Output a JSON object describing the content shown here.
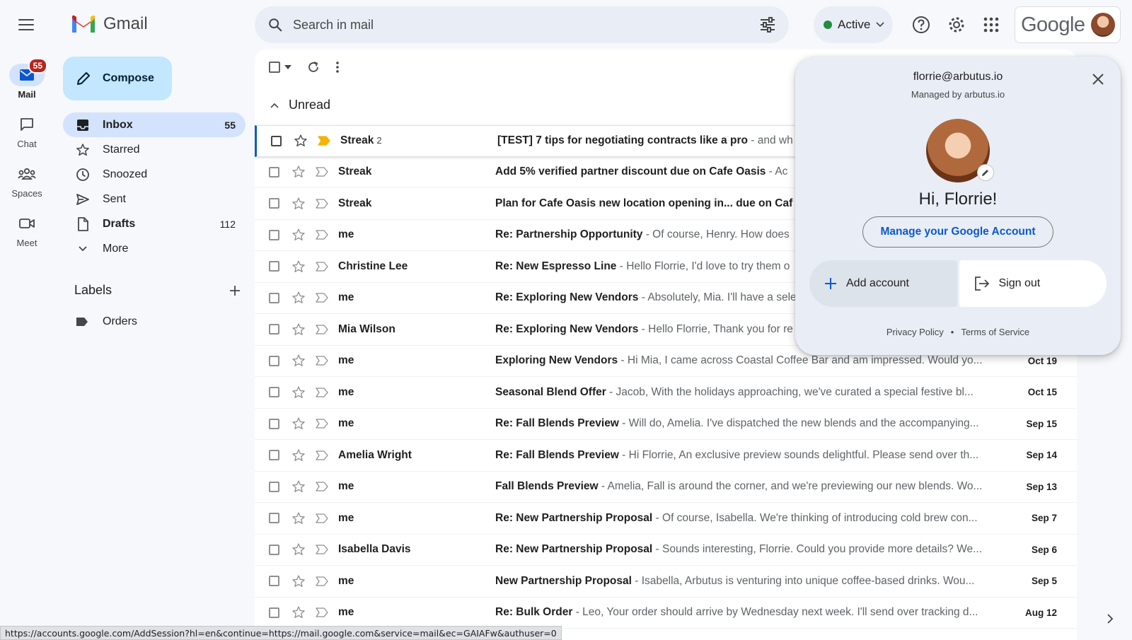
{
  "app": {
    "name": "Gmail"
  },
  "search": {
    "placeholder": "Search in mail"
  },
  "status": {
    "label": "Active"
  },
  "account_brand": "Google",
  "rail": [
    {
      "label": "Mail",
      "badge": "55"
    },
    {
      "label": "Chat"
    },
    {
      "label": "Spaces"
    },
    {
      "label": "Meet"
    }
  ],
  "compose_label": "Compose",
  "nav": [
    {
      "label": "Inbox",
      "count": "55"
    },
    {
      "label": "Starred",
      "count": ""
    },
    {
      "label": "Snoozed",
      "count": ""
    },
    {
      "label": "Sent",
      "count": ""
    },
    {
      "label": "Drafts",
      "count": "112"
    },
    {
      "label": "More",
      "count": ""
    }
  ],
  "labels": {
    "title": "Labels",
    "items": [
      {
        "label": "Orders"
      }
    ]
  },
  "section": {
    "title": "Unread"
  },
  "emails": [
    {
      "sender": "Streak",
      "count": "2",
      "subject": "[TEST] 7 tips for negotiating contracts like a pro",
      "snippet": " - and wh",
      "date": ""
    },
    {
      "sender": "Streak",
      "count": "",
      "subject": "Add 5% verified partner discount due on Cafe Oasis",
      "snippet": " - Ac",
      "date": ""
    },
    {
      "sender": "Streak",
      "count": "",
      "subject": "Plan for Cafe Oasis new location opening in... due on Caf",
      "snippet": "",
      "date": ""
    },
    {
      "sender": "me",
      "count": "",
      "subject": "Re: Partnership Opportunity",
      "snippet": " - Of course, Henry. How does",
      "date": ""
    },
    {
      "sender": "Christine Lee",
      "count": "",
      "subject": "Re: New Espresso Line",
      "snippet": " - Hello Florrie, I'd love to try them o",
      "date": ""
    },
    {
      "sender": "me",
      "count": "",
      "subject": "Re: Exploring New Vendors",
      "snippet": " - Absolutely, Mia. I'll have a sele",
      "date": ""
    },
    {
      "sender": "Mia Wilson",
      "count": "",
      "subject": "Re: Exploring New Vendors",
      "snippet": " - Hello Florrie, Thank you for re",
      "date": ""
    },
    {
      "sender": "me",
      "count": "",
      "subject": "Exploring New Vendors",
      "snippet": " - Hi Mia, I came across Coastal Coffee Bar and am impressed. Would yo...",
      "date": "Oct 19"
    },
    {
      "sender": "me",
      "count": "",
      "subject": "Seasonal Blend Offer",
      "snippet": " - Jacob, With the holidays approaching, we've curated a special festive bl...",
      "date": "Oct 15"
    },
    {
      "sender": "me",
      "count": "",
      "subject": "Re: Fall Blends Preview",
      "snippet": " - Will do, Amelia. I've dispatched the new blends and the accompanying...",
      "date": "Sep 15"
    },
    {
      "sender": "Amelia Wright",
      "count": "",
      "subject": "Re: Fall Blends Preview",
      "snippet": " - Hi Florrie, An exclusive preview sounds delightful. Please send over th...",
      "date": "Sep 14"
    },
    {
      "sender": "me",
      "count": "",
      "subject": "Fall Blends Preview",
      "snippet": " - Amelia, Fall is around the corner, and we're previewing our new blends. Wo...",
      "date": "Sep 13"
    },
    {
      "sender": "me",
      "count": "",
      "subject": "Re: New Partnership Proposal",
      "snippet": " - Of course, Isabella. We're thinking of introducing cold brew con...",
      "date": "Sep 7"
    },
    {
      "sender": "Isabella Davis",
      "count": "",
      "subject": "Re: New Partnership Proposal",
      "snippet": " - Sounds interesting, Florrie. Could you provide more details? We...",
      "date": "Sep 6"
    },
    {
      "sender": "me",
      "count": "",
      "subject": "New Partnership Proposal",
      "snippet": " - Isabella, Arbutus is venturing into unique coffee-based drinks. Wou...",
      "date": "Sep 5"
    },
    {
      "sender": "me",
      "count": "",
      "subject": "Re: Bulk Order",
      "snippet": " - Leo, Your order should arrive by Wednesday next week. I'll send over tracking d...",
      "date": "Aug 12"
    }
  ],
  "account_popup": {
    "email": "florrie@arbutus.io",
    "managed": "Managed by arbutus.io",
    "greeting": "Hi, Florrie!",
    "manage_label": "Manage your Google Account",
    "add_label": "Add account",
    "signout_label": "Sign out",
    "privacy": "Privacy Policy",
    "separator": "•",
    "terms": "Terms of Service"
  },
  "status_url": "https://accounts.google.com/AddSession?hl=en&continue=https://mail.google.com&service=mail&ec=GAIAFw&authuser=0",
  "colors": {
    "accent": "#0b57d0",
    "compose": "#c2e7ff",
    "nav_active": "#d3e3fd",
    "badge": "#b3261e",
    "active_dot": "#1e8e3e"
  }
}
